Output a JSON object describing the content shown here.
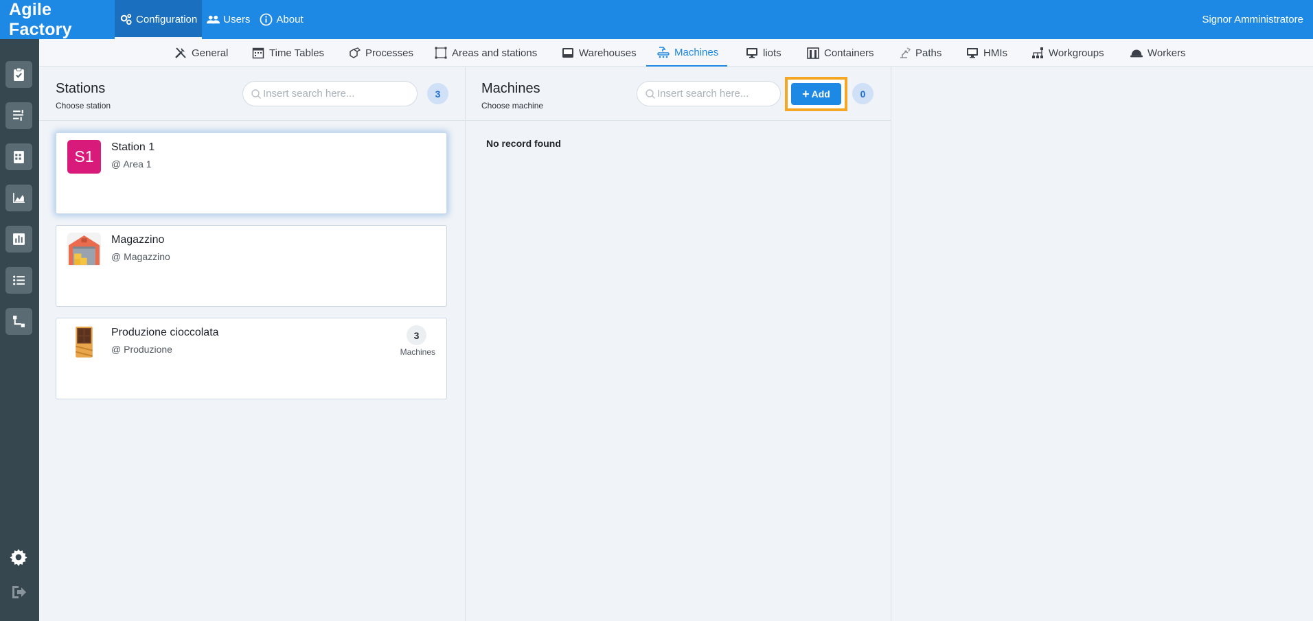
{
  "app": {
    "title": "Agile Factory",
    "user": "Signor Amministratore"
  },
  "topnav": [
    {
      "label": "Configuration",
      "icon": "gears-icon",
      "active": true
    },
    {
      "label": "Users",
      "icon": "users-icon"
    },
    {
      "label": "About",
      "icon": "info-icon"
    }
  ],
  "sidebar": [
    "clipboard-check-icon",
    "tasks-icon",
    "calendar-icon",
    "area-chart-icon",
    "bar-chart-icon",
    "list-icon",
    "flow-icon",
    "gear-icon",
    "logout-icon"
  ],
  "tabs": [
    {
      "label": "General",
      "icon": "tools-icon"
    },
    {
      "label": "Time Tables",
      "icon": "calendar-icon"
    },
    {
      "label": "Processes",
      "icon": "cubes-icon"
    },
    {
      "label": "Areas and stations",
      "icon": "area-icon"
    },
    {
      "label": "Warehouses",
      "icon": "inbox-icon"
    },
    {
      "label": "Machines",
      "icon": "machine-icon",
      "active": true
    },
    {
      "label": "liots",
      "icon": "monitor-icon"
    },
    {
      "label": "Containers",
      "icon": "container-icon"
    },
    {
      "label": "Paths",
      "icon": "robot-arm-icon"
    },
    {
      "label": "HMIs",
      "icon": "monitor-icon"
    },
    {
      "label": "Workgroups",
      "icon": "sitemap-icon"
    },
    {
      "label": "Workers",
      "icon": "hard-hat-icon"
    }
  ],
  "stations": {
    "title": "Stations",
    "subtitle": "Choose station",
    "search_placeholder": "Insert search here...",
    "count": "3",
    "items": [
      {
        "initials": "S1",
        "name": "Station 1",
        "area": "@ Area 1",
        "color": "#d81b7a",
        "selected": true
      },
      {
        "name": "Magazzino",
        "area": "@ Magazzino",
        "image": "warehouse-image"
      },
      {
        "name": "Produzione cioccolata",
        "area": "@ Produzione",
        "image": "chocolate-image",
        "machines_count": "3",
        "machines_label": "Machines"
      }
    ]
  },
  "machines": {
    "title": "Machines",
    "subtitle": "Choose machine",
    "search_placeholder": "Insert search here...",
    "add_label": "Add",
    "count": "0",
    "empty_text": "No record found"
  },
  "colors": {
    "primary": "#1e88e5",
    "sidebar": "#37474f",
    "highlight": "#f5a623"
  }
}
